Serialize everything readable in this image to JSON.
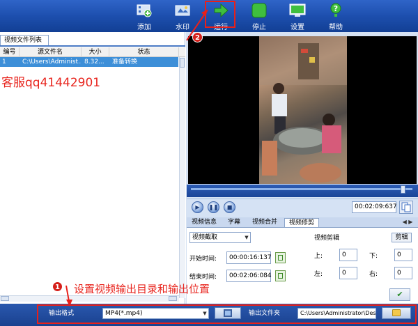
{
  "toolbar": {
    "buttons": [
      {
        "label": "添加",
        "icon": "film-add-icon"
      },
      {
        "label": "水印",
        "icon": "watermark-icon"
      },
      {
        "label": "运行",
        "icon": "run-arrow-icon"
      },
      {
        "label": "停止",
        "icon": "stop-icon"
      },
      {
        "label": "设置",
        "icon": "settings-monitor-icon"
      },
      {
        "label": "帮助",
        "icon": "help-icon"
      }
    ]
  },
  "file_list": {
    "tab_label": "视频文件列表",
    "columns": [
      "编号",
      "源文件名",
      "大小",
      "状态"
    ],
    "rows": [
      {
        "num": "1",
        "file": "C:\\Users\\Administ...",
        "size": "8.32...",
        "status": "准备转换"
      }
    ]
  },
  "watermark_text": "客服qq41442901",
  "player": {
    "time": "00:02:09:637"
  },
  "tabs": [
    "视频信息",
    "字幕",
    "视频合并",
    "视频修剪"
  ],
  "active_tab": "视频修剪",
  "trim": {
    "mode": "视频截取",
    "start_label": "开始时间:",
    "start_value": "00:00:16:137",
    "end_label": "结束时间:",
    "end_value": "00:02:06:084",
    "crop_title": "视频剪辑",
    "crop_button": "剪辑",
    "top_label": "上:",
    "top_value": "0",
    "bottom_label": "下:",
    "bottom_value": "0",
    "left_label": "左:",
    "left_value": "0",
    "right_label": "右:",
    "right_value": "0"
  },
  "output": {
    "format_label": "输出格式",
    "format_value": "MP4(*.mp4)",
    "folder_label": "输出文件夹",
    "folder_value": "C:\\Users\\Administrator\\Des"
  },
  "annotations": {
    "badge1": "1",
    "badge2": "2",
    "note": "设置视频输出目录和输出位置",
    "color": "#e8201a"
  }
}
